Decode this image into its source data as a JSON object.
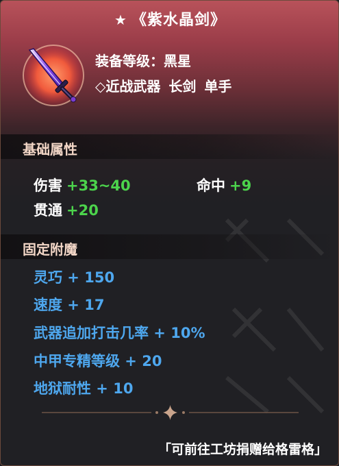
{
  "item": {
    "star": "★",
    "name": "《紫水晶剑》",
    "icon": "purple-sword-icon",
    "equip_level_label": "装备等级：",
    "equip_level_value": "黑星",
    "type_marker": "◇",
    "type_parts": [
      "近战武器",
      "长剑",
      "单手"
    ]
  },
  "basic_section": {
    "header": "基础属性",
    "stats": [
      {
        "label": "伤害",
        "value": "+33~40"
      },
      {
        "label": "命中",
        "value": "+9"
      },
      {
        "label": "贯通",
        "value": "+20"
      }
    ]
  },
  "enchant_section": {
    "header": "固定附魔",
    "lines": [
      "灵巧 + 150",
      "速度 + 17",
      "武器追加打击几率 + 10%",
      "中甲专精等级 + 20",
      "地狱耐性 + 10"
    ]
  },
  "footer": "「可前往工坊捐赠给格雷格」",
  "colors": {
    "stat_value": "#4cd44c",
    "enchant": "#4ea7ee",
    "header_text": "#f3d7c7"
  }
}
